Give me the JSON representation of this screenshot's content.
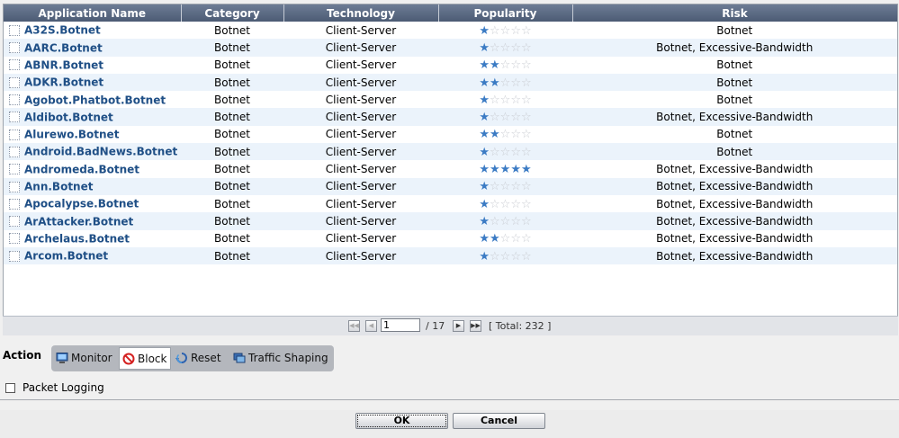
{
  "grid": {
    "columns": [
      "Application Name",
      "Category",
      "Technology",
      "Popularity",
      "Risk"
    ],
    "rows": [
      {
        "name": "A32S.Botnet",
        "category": "Botnet",
        "technology": "Client-Server",
        "popularity": 1,
        "risk": "Botnet"
      },
      {
        "name": "AARC.Botnet",
        "category": "Botnet",
        "technology": "Client-Server",
        "popularity": 1,
        "risk": "Botnet, Excessive-Bandwidth"
      },
      {
        "name": "ABNR.Botnet",
        "category": "Botnet",
        "technology": "Client-Server",
        "popularity": 2,
        "risk": "Botnet"
      },
      {
        "name": "ADKR.Botnet",
        "category": "Botnet",
        "technology": "Client-Server",
        "popularity": 2,
        "risk": "Botnet"
      },
      {
        "name": "Agobot.Phatbot.Botnet",
        "category": "Botnet",
        "technology": "Client-Server",
        "popularity": 1,
        "risk": "Botnet"
      },
      {
        "name": "Aldibot.Botnet",
        "category": "Botnet",
        "technology": "Client-Server",
        "popularity": 1,
        "risk": "Botnet, Excessive-Bandwidth"
      },
      {
        "name": "Alurewo.Botnet",
        "category": "Botnet",
        "technology": "Client-Server",
        "popularity": 2,
        "risk": "Botnet"
      },
      {
        "name": "Android.BadNews.Botnet",
        "category": "Botnet",
        "technology": "Client-Server",
        "popularity": 1,
        "risk": "Botnet"
      },
      {
        "name": "Andromeda.Botnet",
        "category": "Botnet",
        "technology": "Client-Server",
        "popularity": 5,
        "risk": "Botnet, Excessive-Bandwidth"
      },
      {
        "name": "Ann.Botnet",
        "category": "Botnet",
        "technology": "Client-Server",
        "popularity": 1,
        "risk": "Botnet, Excessive-Bandwidth"
      },
      {
        "name": "Apocalypse.Botnet",
        "category": "Botnet",
        "technology": "Client-Server",
        "popularity": 1,
        "risk": "Botnet, Excessive-Bandwidth"
      },
      {
        "name": "ArAttacker.Botnet",
        "category": "Botnet",
        "technology": "Client-Server",
        "popularity": 1,
        "risk": "Botnet, Excessive-Bandwidth"
      },
      {
        "name": "Archelaus.Botnet",
        "category": "Botnet",
        "technology": "Client-Server",
        "popularity": 2,
        "risk": "Botnet, Excessive-Bandwidth"
      },
      {
        "name": "Arcom.Botnet",
        "category": "Botnet",
        "technology": "Client-Server",
        "popularity": 1,
        "risk": "Botnet, Excessive-Bandwidth"
      }
    ],
    "popularity_max": 5,
    "colors": {
      "header": "#5a6a84",
      "row_alt": "#ebf3fb",
      "link": "#1f4f86",
      "star_on": "#3b7bc4",
      "star_off": "#c9ccd2"
    }
  },
  "pager": {
    "page_value": "1",
    "total_pages": "/ 17",
    "total": "[ Total:  232 ]",
    "icons": [
      "first-page-icon",
      "prev-page-icon",
      "next-page-icon",
      "last-page-icon"
    ]
  },
  "action": {
    "label": "Action",
    "options": [
      {
        "label": "Monitor",
        "icon": "monitor-icon",
        "selected": false
      },
      {
        "label": "Block",
        "icon": "block-icon",
        "selected": true
      },
      {
        "label": "Reset",
        "icon": "reset-icon",
        "selected": false
      },
      {
        "label": "Traffic Shaping",
        "icon": "traffic-shaping-icon",
        "selected": false
      }
    ]
  },
  "packet_logging": {
    "label": "Packet Logging",
    "checked": false
  },
  "buttons": {
    "ok": "OK",
    "cancel": "Cancel"
  }
}
